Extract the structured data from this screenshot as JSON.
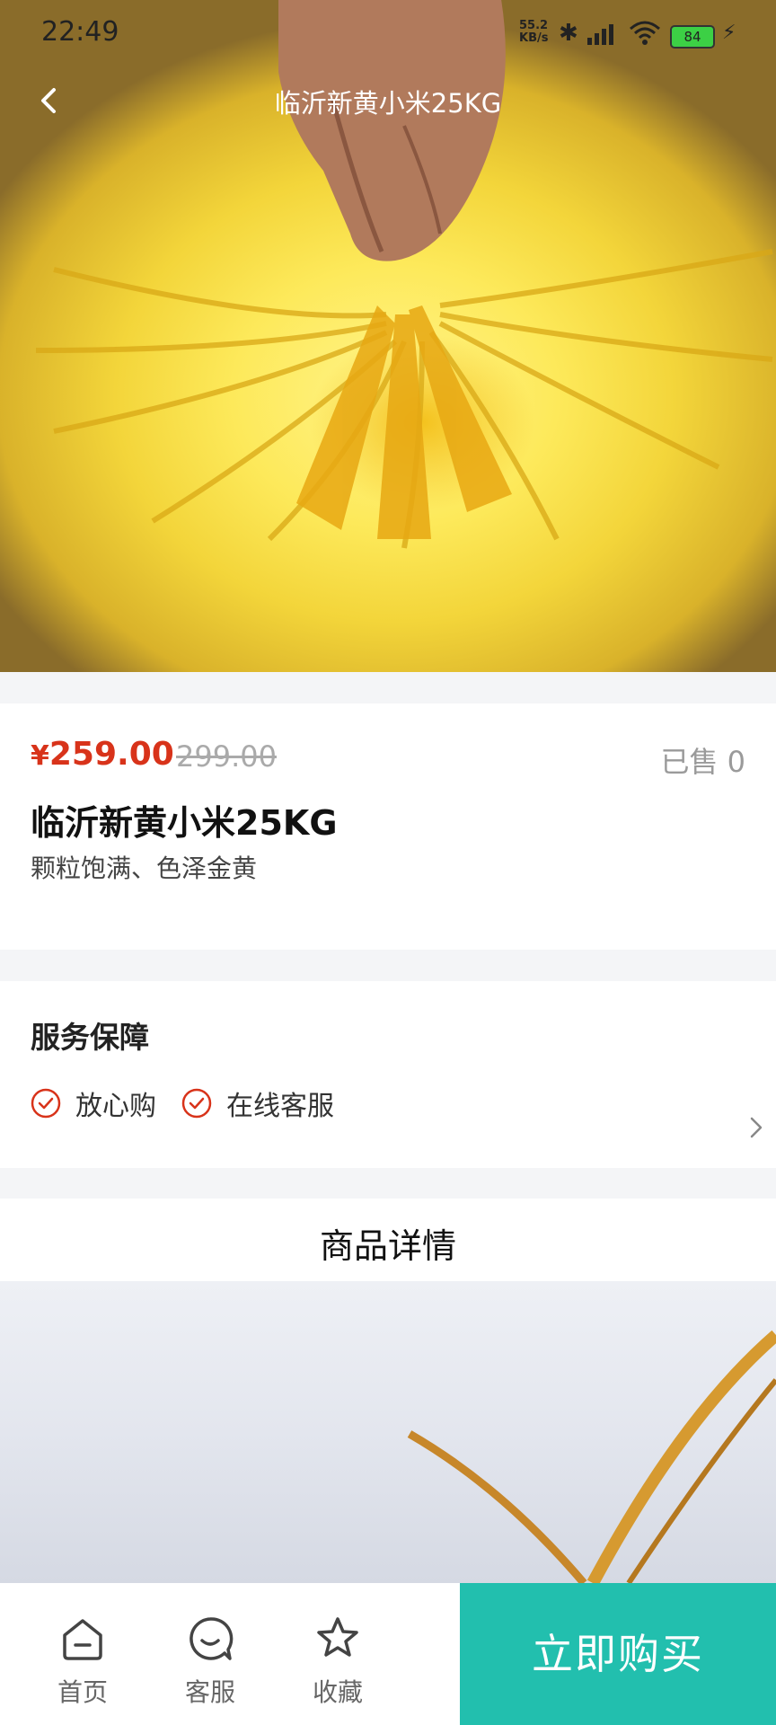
{
  "status_bar": {
    "time": "22:49",
    "net_speed_top": "55.2",
    "net_speed_bottom": "KB/s",
    "battery": "84"
  },
  "nav": {
    "title": "临沂新黄小米25KG"
  },
  "product": {
    "currency": "¥",
    "price": "259.00",
    "original_price": "299.00",
    "sold_label": "已售 0",
    "title": "临沂新黄小米25KG",
    "subtitle": "颗粒饱满、色泽金黄"
  },
  "service": {
    "title": "服务保障",
    "items": [
      "放心购",
      "在线客服"
    ]
  },
  "detail": {
    "title": "商品详情"
  },
  "bottom_bar": {
    "tabs": [
      {
        "label": "首页",
        "icon": "home-icon"
      },
      {
        "label": "客服",
        "icon": "customer-service-icon"
      },
      {
        "label": "收藏",
        "icon": "star-icon"
      }
    ],
    "buy_label": "立即购买"
  },
  "colors": {
    "price_red": "#d8331a",
    "buy_teal": "#22bfae",
    "check_red": "#d8331a"
  }
}
